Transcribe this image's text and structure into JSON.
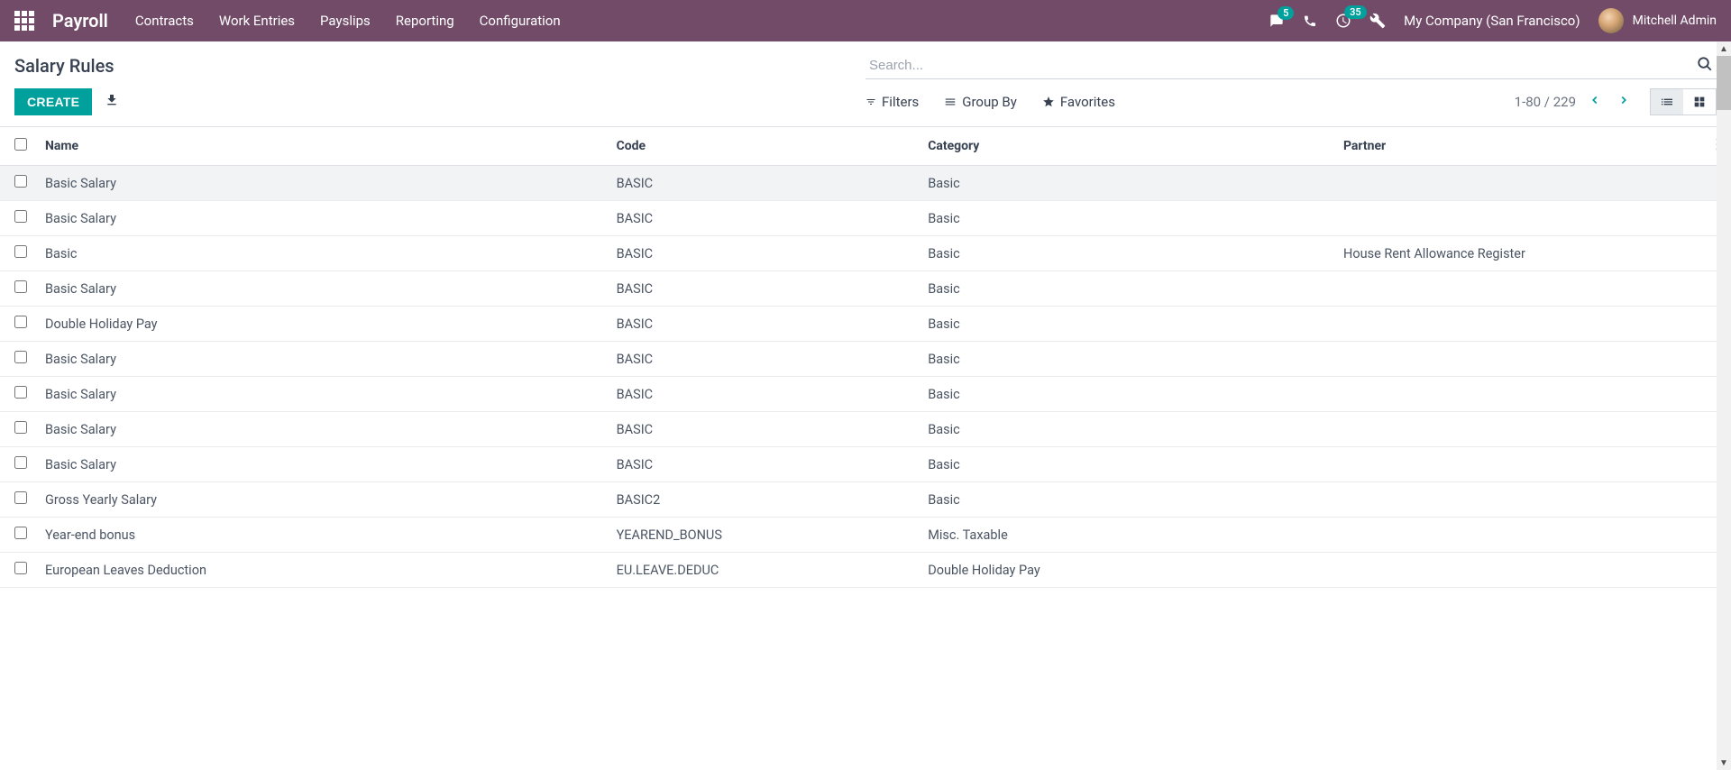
{
  "navbar": {
    "brand": "Payroll",
    "menu": [
      "Contracts",
      "Work Entries",
      "Payslips",
      "Reporting",
      "Configuration"
    ],
    "msg_badge": "5",
    "activity_badge": "35",
    "company": "My Company (San Francisco)",
    "user": "Mitchell Admin"
  },
  "breadcrumb": "Salary Rules",
  "search_placeholder": "Search...",
  "buttons": {
    "create": "CREATE"
  },
  "filter_bar": {
    "filters": "Filters",
    "group_by": "Group By",
    "favorites": "Favorites"
  },
  "pager": {
    "range": "1-80 / 229"
  },
  "table": {
    "headers": {
      "name": "Name",
      "code": "Code",
      "category": "Category",
      "partner": "Partner"
    },
    "rows": [
      {
        "name": "Basic Salary",
        "code": "BASIC",
        "category": "Basic",
        "partner": "",
        "highlight": true
      },
      {
        "name": "Basic Salary",
        "code": "BASIC",
        "category": "Basic",
        "partner": ""
      },
      {
        "name": "Basic",
        "code": "BASIC",
        "category": "Basic",
        "partner": "House Rent Allowance Register"
      },
      {
        "name": "Basic Salary",
        "code": "BASIC",
        "category": "Basic",
        "partner": ""
      },
      {
        "name": "Double Holiday Pay",
        "code": "BASIC",
        "category": "Basic",
        "partner": ""
      },
      {
        "name": "Basic Salary",
        "code": "BASIC",
        "category": "Basic",
        "partner": ""
      },
      {
        "name": "Basic Salary",
        "code": "BASIC",
        "category": "Basic",
        "partner": ""
      },
      {
        "name": "Basic Salary",
        "code": "BASIC",
        "category": "Basic",
        "partner": ""
      },
      {
        "name": "Basic Salary",
        "code": "BASIC",
        "category": "Basic",
        "partner": ""
      },
      {
        "name": "Gross Yearly Salary",
        "code": "BASIC2",
        "category": "Basic",
        "partner": ""
      },
      {
        "name": "Year-end bonus",
        "code": "YEAREND_BONUS",
        "category": "Misc. Taxable",
        "partner": ""
      },
      {
        "name": "European Leaves Deduction",
        "code": "EU.LEAVE.DEDUC",
        "category": "Double Holiday Pay",
        "partner": ""
      }
    ]
  }
}
